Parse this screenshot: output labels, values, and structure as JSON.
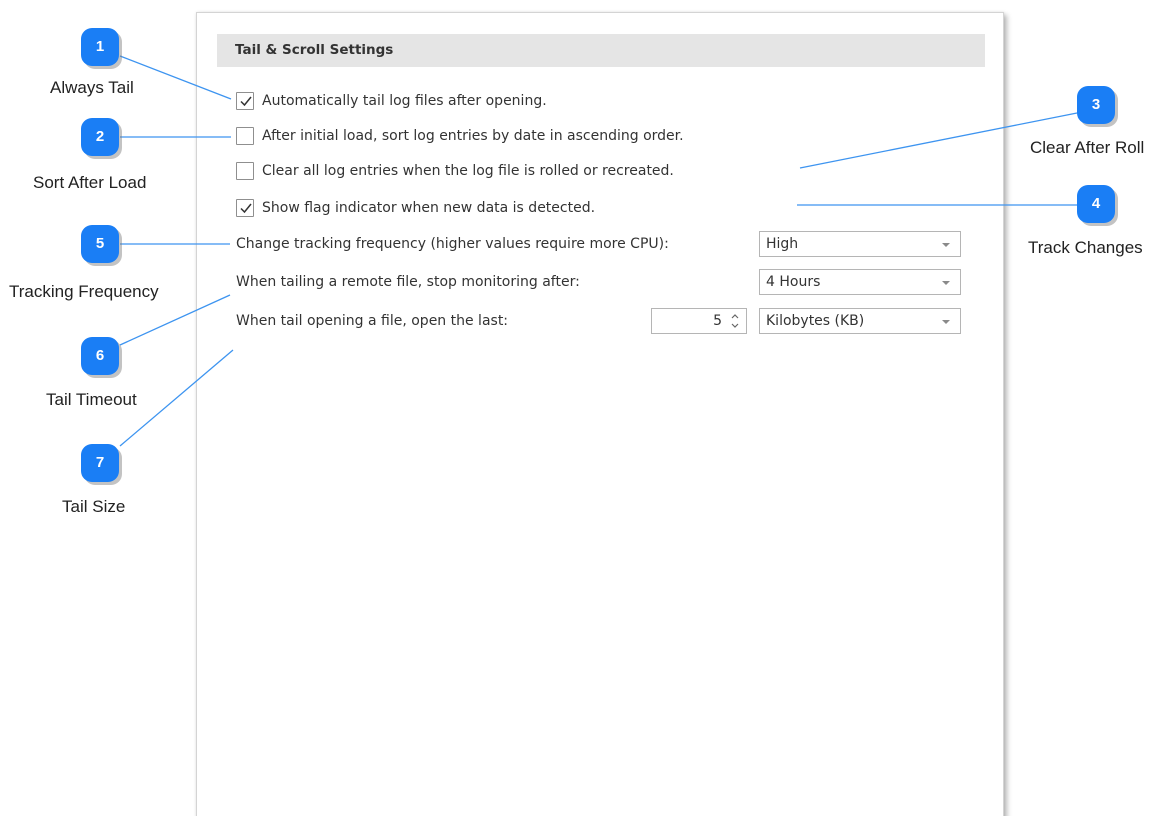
{
  "section": {
    "title": "Tail & Scroll Settings"
  },
  "options": [
    {
      "label": "Automatically tail log files after opening.",
      "checked": true
    },
    {
      "label": "After initial load, sort log entries by date in ascending order.",
      "checked": false
    },
    {
      "label": "Clear all log entries when the log file is rolled or recreated.",
      "checked": false
    },
    {
      "label": "Show flag indicator when new data is detected.",
      "checked": true
    }
  ],
  "tracking": {
    "label": "Change tracking frequency (higher values require more CPU):",
    "value": "High"
  },
  "timeout": {
    "label": "When tailing a remote file, stop monitoring after:",
    "value": "4 Hours"
  },
  "tail_size": {
    "label": "When tail opening a file, open the last:",
    "amount": "5",
    "unit": "Kilobytes (KB)"
  },
  "callouts": [
    {
      "number": "1",
      "label": "Always Tail"
    },
    {
      "number": "2",
      "label": "Sort After Load"
    },
    {
      "number": "3",
      "label": "Clear After Roll"
    },
    {
      "number": "4",
      "label": "Track Changes"
    },
    {
      "number": "5",
      "label": "Tracking Frequency"
    },
    {
      "number": "6",
      "label": "Tail Timeout"
    },
    {
      "number": "7",
      "label": "Tail Size"
    }
  ],
  "colors": {
    "badge": "#1a7ef5",
    "callout_line": "#3d94f0",
    "header_bg": "#e5e5e5"
  }
}
